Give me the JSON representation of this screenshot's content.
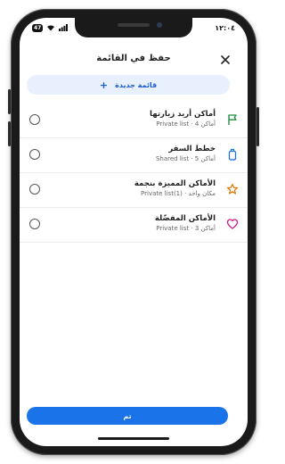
{
  "status_bar": {
    "time": "١٢:٠٤",
    "battery": "47"
  },
  "header": {
    "title": "حفظ في القائمة"
  },
  "new_list": {
    "label": "قائمة جديدة",
    "plus": "+"
  },
  "lists": [
    {
      "name": "أماكن أريد زيارتها",
      "sub": "Private list · 4 أماكن",
      "icon": "flag-icon",
      "color": "#1e8e3e"
    },
    {
      "name": "خطط السفر",
      "sub": "Shared list · 5 أماكن",
      "icon": "suitcase-icon",
      "color": "#1a73e8"
    },
    {
      "name": "الأماكن المميزة بنجمة",
      "sub": "Private list(1) · مكان واحد",
      "icon": "star-icon",
      "color": "#e37400"
    },
    {
      "name": "الأماكن المفضّلة",
      "sub": "Private list · 3 أماكن",
      "icon": "heart-icon",
      "color": "#d01884"
    }
  ],
  "footer": {
    "done_label": "تم"
  },
  "colors": {
    "accent": "#1a73e8",
    "new_list_bg": "#e8f0fd"
  }
}
